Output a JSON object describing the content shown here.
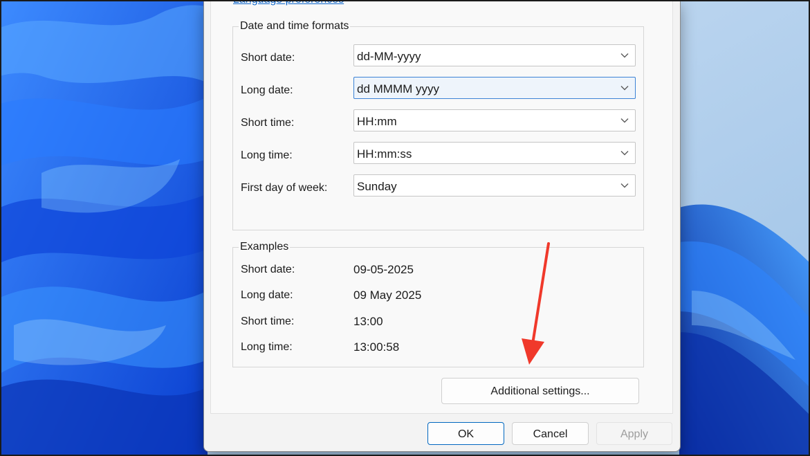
{
  "dialog": {
    "language_link": "Language preferences",
    "formats_group": {
      "title": "Date and time formats",
      "rows": [
        {
          "label": "Short date:",
          "value": "dd-MM-yyyy"
        },
        {
          "label": "Long date:",
          "value": "dd MMMM yyyy"
        },
        {
          "label": "Short time:",
          "value": "HH:mm"
        },
        {
          "label": "Long time:",
          "value": "HH:mm:ss"
        },
        {
          "label": "First day of week:",
          "value": "Sunday"
        }
      ]
    },
    "examples_group": {
      "title": "Examples",
      "rows": [
        {
          "label": "Short date:",
          "value": "09-05-2025"
        },
        {
          "label": "Long date:",
          "value": "09 May 2025"
        },
        {
          "label": "Short time:",
          "value": "13:00"
        },
        {
          "label": "Long time:",
          "value": "13:00:58"
        }
      ]
    },
    "additional_settings": "Additional settings...",
    "buttons": {
      "ok": "OK",
      "cancel": "Cancel",
      "apply": "Apply"
    }
  },
  "colors": {
    "accent": "#0067c0",
    "link": "#0a63c9",
    "annotation_arrow": "#f0392b"
  },
  "icons": {
    "dropdown": "chevron-down-icon",
    "annotation": "red-arrow"
  }
}
